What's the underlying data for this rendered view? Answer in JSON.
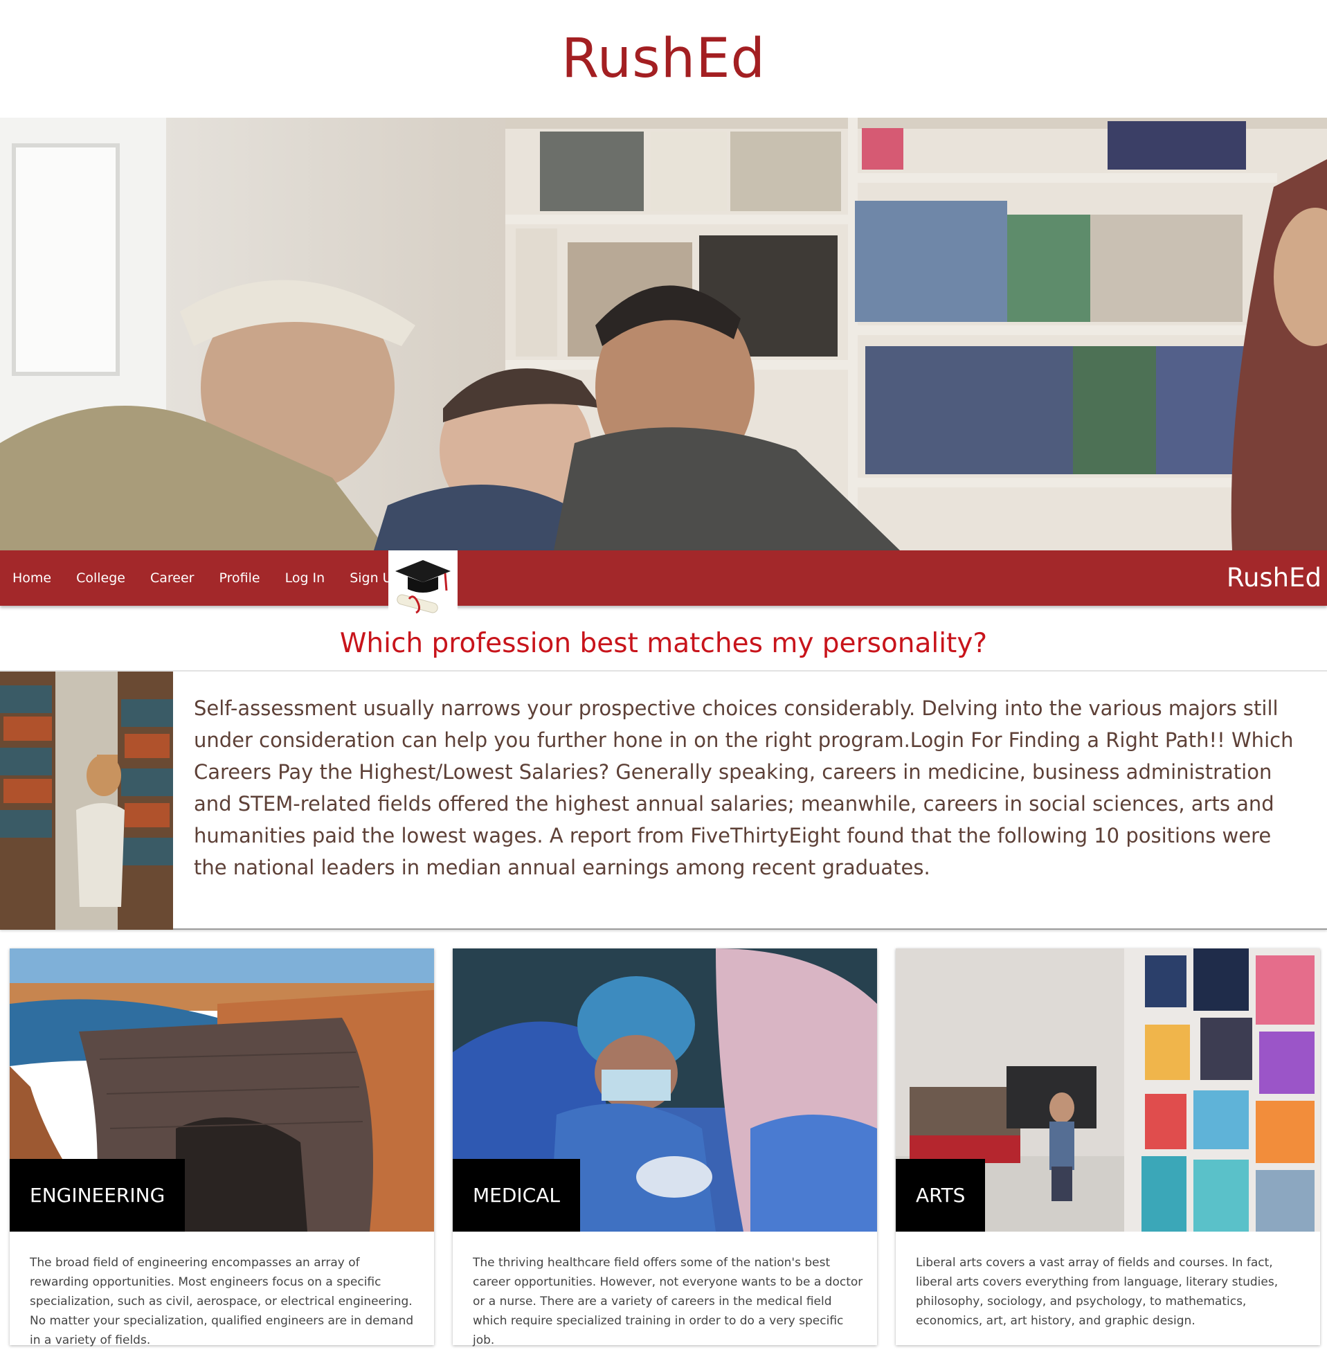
{
  "site_title": "RushEd",
  "nav": {
    "items": [
      {
        "label": "Home"
      },
      {
        "label": "College"
      },
      {
        "label": "Career"
      },
      {
        "label": "Profile"
      },
      {
        "label": "Log In"
      },
      {
        "label": "Sign Up"
      }
    ],
    "brand": "RushEd"
  },
  "question": "Which profession best matches my personality?",
  "intro": {
    "text": "Self-assessment usually narrows your prospective choices considerably. Delving into the various majors still under consideration can help you further hone in on the right program.Login For Finding a Right Path!! Which Careers Pay the Highest/Lowest Salaries? Generally speaking, careers in medicine, business administration and STEM-related fields offered the highest annual salaries; meanwhile, careers in social sciences, arts and humanities paid the lowest wages. A report from FiveThirtyEight found that the following 10 positions were the national leaders in median annual earnings among recent graduates."
  },
  "cards": [
    {
      "title": "ENGINEERING",
      "text": "The broad field of engineering encompasses an array of rewarding opportunities. Most engineers focus on a specific specialization, such as civil, aerospace, or electrical engineering. No matter your specialization, qualified engineers are in demand in a variety of fields."
    },
    {
      "title": "MEDICAL",
      "text": "The thriving healthcare field offers some of the nation's best career opportunities. However, not everyone wants to be a doctor or a nurse. There are a variety of careers in the medical field which require specialized training in order to do a very specific job."
    },
    {
      "title": "ARTS",
      "text": "Liberal arts covers a vast array of fields and courses. In fact, liberal arts covers everything from language, literary studies, philosophy, sociology, and psychology, to mathematics, economics, art, art history, and graphic design."
    }
  ],
  "colors": {
    "brand_red": "#a3282a",
    "question_red": "#c8141b",
    "intro_text": "#5d4037"
  },
  "icons": {
    "nav_logo": "graduation-cap-diploma-icon"
  }
}
